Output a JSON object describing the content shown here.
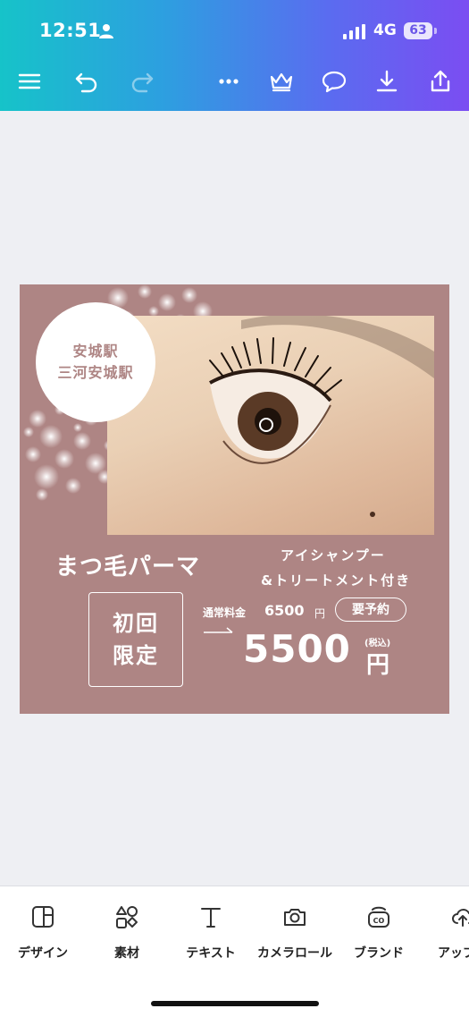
{
  "status_bar": {
    "time": "12:51",
    "network": "4G",
    "battery": "63"
  },
  "toolbar": {
    "icons": [
      "menu-icon",
      "undo-icon",
      "redo-icon",
      "more-icon",
      "crown-icon",
      "comment-icon",
      "download-icon",
      "share-icon"
    ]
  },
  "design": {
    "background_color": "#ae8584",
    "stations": [
      "安城駅",
      "三河安城駅"
    ],
    "title": "まつ毛パーマ",
    "subtitle_line1": "アイシャンプー",
    "subtitle_line2": "&トリートメント付き",
    "first_time": [
      "初回",
      "限定"
    ],
    "normal_price_label": "通常料金",
    "normal_price": "6500",
    "normal_price_unit": "円",
    "reserve_label": "要予約",
    "price": "5500",
    "tax_note": "(税込)",
    "price_unit": "円"
  },
  "bottom_toolbar": {
    "items": [
      {
        "label": "デザイン",
        "icon": "design-icon"
      },
      {
        "label": "素材",
        "icon": "elements-icon"
      },
      {
        "label": "テキスト",
        "icon": "text-icon"
      },
      {
        "label": "カメラロール",
        "icon": "camera-icon"
      },
      {
        "label": "ブランド",
        "icon": "brand-icon"
      },
      {
        "label": "アップロ",
        "icon": "upload-cloud-icon"
      }
    ]
  }
}
